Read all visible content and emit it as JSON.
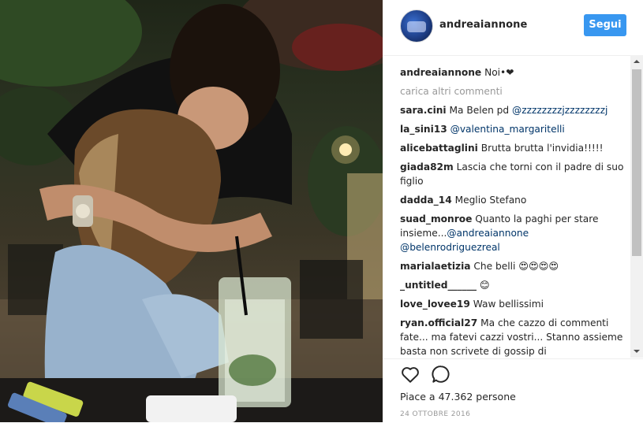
{
  "post": {
    "username": "andreaiannone",
    "follow_label": "Segui",
    "caption_user": "andreaiannone",
    "caption_text": "Noi•❤",
    "load_more": "carica altri commenti",
    "likes_text": "Piace a 47.362 persone",
    "date": "24 OTTOBRE 2016"
  },
  "comments": [
    {
      "user": "sara.cini",
      "pre": "Ma Belen pd ",
      "mention": "@zzzzzzzzjzzzzzzzzj",
      "post": ""
    },
    {
      "user": "la_sini13",
      "pre": "",
      "mention": "@valentina_margaritelli",
      "post": ""
    },
    {
      "user": "alicebattaglini",
      "pre": "Brutta brutta l'invidia!!!!!",
      "mention": "",
      "post": ""
    },
    {
      "user": "giada82m",
      "pre": "Lascia che torni con il padre di suo figlio",
      "mention": "",
      "post": ""
    },
    {
      "user": "dadda_14",
      "pre": "Meglio Stefano",
      "mention": "",
      "post": ""
    },
    {
      "user": "suad_monroe",
      "pre": "Quanto la paghi per stare insieme...",
      "mention": "@andreaiannone @belenrodriguezreal",
      "post": ""
    },
    {
      "user": "marialaetizia",
      "pre": "Che belli 😍😍😍😍",
      "mention": "",
      "post": ""
    },
    {
      "user": "_untitled______",
      "pre": "😊",
      "mention": "",
      "post": ""
    },
    {
      "user": "love_lovee19",
      "pre": "Waw bellissimi",
      "mention": "",
      "post": ""
    },
    {
      "user": "ryan.official27",
      "pre": "Ma che cazzo di commenti fate... ma fatevi cazzi vostri... Stanno assieme basta non scrivete di gossip di",
      "mention": "",
      "post": ""
    }
  ],
  "icons": {
    "like": "heart-icon",
    "comment": "comment-bubble-icon"
  },
  "colors": {
    "follow_button": "#3897f0",
    "mention": "#003569",
    "muted": "#999999"
  }
}
